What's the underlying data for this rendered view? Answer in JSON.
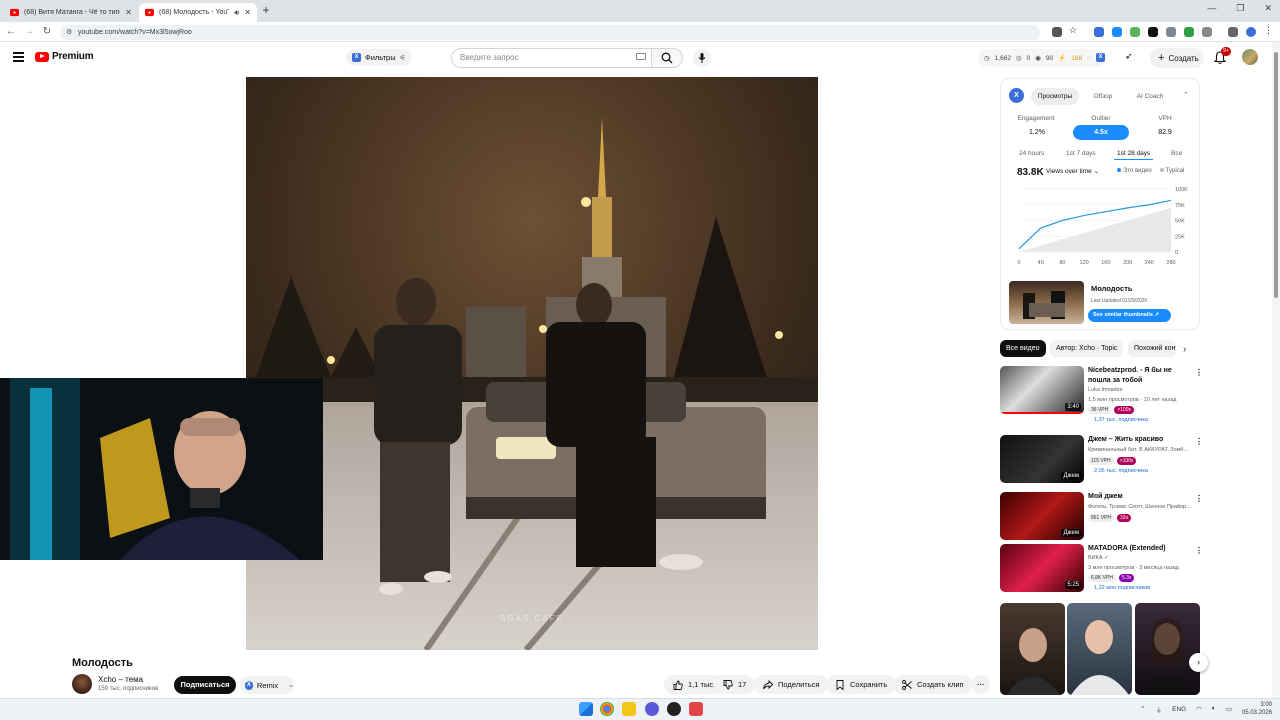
{
  "browser": {
    "tabs": [
      {
        "title": "(68) Витя Матанга - Чё то типо",
        "active": false
      },
      {
        "title": "(68) Молодость - YouTube",
        "active": true
      }
    ],
    "url": "youtube.com/watch?v=Mx3l5owjRoo"
  },
  "header": {
    "logo": "Premium",
    "filters": "Фильтры",
    "search_placeholder": "Введите запрос",
    "stats": [
      "1,662",
      "0",
      "90",
      "168",
      "5"
    ],
    "create": "Создать",
    "notifications": "9+"
  },
  "video": {
    "title": "Молодость",
    "channel": "Xcho – тема",
    "subs": "159 тыс. подписчиков",
    "subscribe": "Подписаться",
    "remix": "Remix",
    "likes": "1,1 тыс.",
    "dislikes": "17",
    "share": "Поделиться",
    "save": "Сохранить",
    "clip": "Создать клип",
    "watermark": "SGAS CAFE"
  },
  "panel": {
    "tabs": [
      "Просмотры",
      "Обзор",
      "AI Coach"
    ],
    "metrics": [
      {
        "label": "Engagement",
        "value": "1.2%"
      },
      {
        "label": "Outlier",
        "value": "4.5x"
      },
      {
        "label": "VPH",
        "value": "82.9"
      }
    ],
    "ranges": [
      "24 hours",
      "1st 7 days",
      "1st 28 days",
      "Все"
    ],
    "big_views": "83.8K",
    "views_mode": "Views over time",
    "legend": [
      "Это видео",
      "Typical"
    ],
    "title": "Молодость",
    "updated": "Last Updated 01/29/2026",
    "similar_btn": "See similar thumbnails"
  },
  "chart_data": {
    "type": "line",
    "x": [
      0,
      40,
      80,
      120,
      160,
      200,
      240,
      280
    ],
    "series": [
      {
        "name": "Это видео",
        "values": [
          5000,
          38000,
          50000,
          58000,
          64000,
          70000,
          75000,
          82000
        ]
      },
      {
        "name": "Typical",
        "values": [
          0,
          10000,
          20000,
          30000,
          40000,
          50000,
          60000,
          70000
        ]
      }
    ],
    "ylim": [
      0,
      100000
    ],
    "yticks": [
      "100K",
      "75K",
      "50K",
      "25K",
      "0"
    ],
    "xticks": [
      "0",
      "40",
      "80",
      "120",
      "160",
      "200",
      "240",
      "280"
    ],
    "grid": true
  },
  "chips": [
    "Все видео",
    "Автор: Xcho · Topic",
    "Похожий контент"
  ],
  "recommendations": [
    {
      "title": "Nicebeatzprod. - Я бы не пошла за тобой",
      "channel": "Luka Imnadze",
      "meta": "1,5 млн просмотров · 10 лет назад",
      "vph": "36 VPH",
      "badge": ">100x",
      "subs": "1,37 тыс. подписчика",
      "duration": "3:40"
    },
    {
      "title": "Джем – Жить красиво",
      "channel": "Криминальный бит, В АККУРАТ, Зомб...",
      "meta": "",
      "vph": "115 VPH",
      "badge": ">100x",
      "subs": "2,05 тыс. подписчика",
      "duration": "Джем"
    },
    {
      "title": "Мой джем",
      "channel": "Фогель, Трэвис Скотт, Шеннон Прайор...",
      "meta": "",
      "vph": "861 VPH",
      "badge": "33x",
      "subs": "",
      "duration": "Джем"
    },
    {
      "title": "MATADORA (Extended)",
      "channel": "ВИКА ✓",
      "meta": "3 млн просмотров · 3 месяца назад",
      "vph": "6.8K VPH",
      "badge": "5.3x",
      "subs": "1,22 млн подписчиков",
      "duration": "5:25"
    }
  ],
  "taskbar": {
    "lang": "ENG",
    "time": "3:00",
    "date": "05.03.2026"
  }
}
